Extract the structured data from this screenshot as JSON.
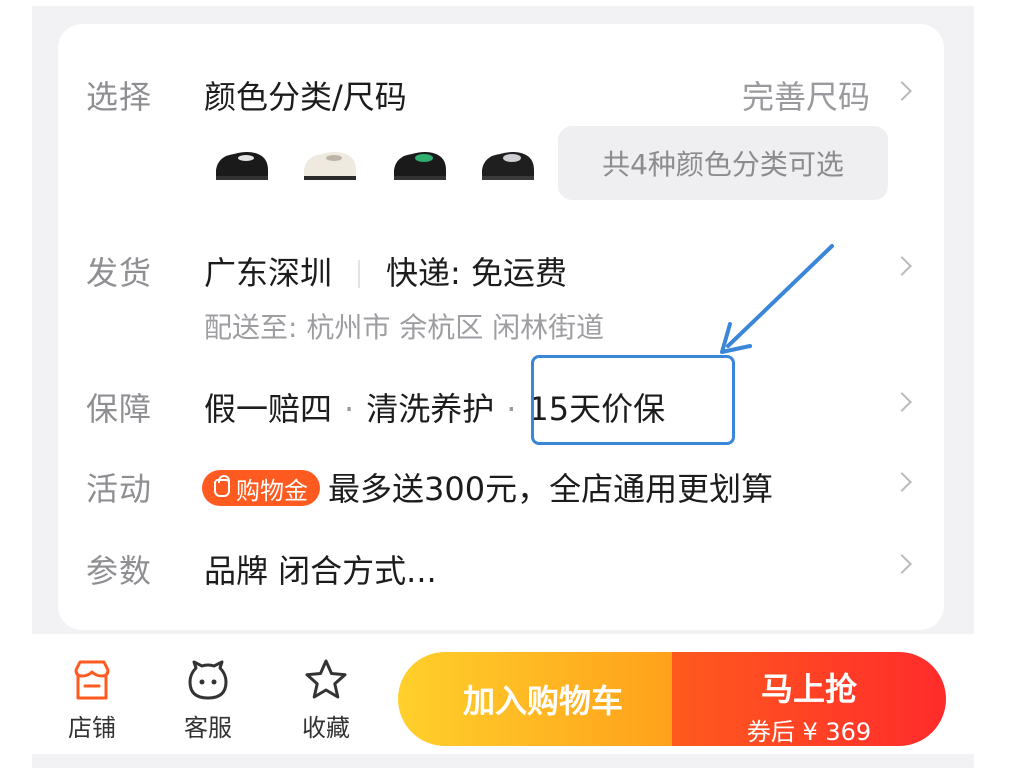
{
  "rows": {
    "select": {
      "label": "选择",
      "value": "颜色分类/尺码",
      "link": "完善尺码",
      "colors_pill": "共4种颜色分类可选",
      "thumbnails": [
        "shoe-black",
        "shoe-white",
        "shoe-green-black",
        "shoe-black-silver"
      ]
    },
    "shipping": {
      "label": "发货",
      "origin": "广东深圳",
      "courier": "快递: 免运费",
      "address": "配送至: 杭州市 余杭区 闲林街道"
    },
    "guarantee": {
      "label": "保障",
      "item1": "假一赔四",
      "item2": "清洗养护",
      "item3": "15天价保",
      "dot": "·"
    },
    "promo": {
      "label": "活动",
      "chip": "购物金",
      "text": "最多送300元，全店通用更划算"
    },
    "params": {
      "label": "参数",
      "value": "品牌 闭合方式..."
    }
  },
  "bottom_bar": {
    "store": "店铺",
    "service": "客服",
    "favorite": "收藏",
    "add_to_cart": "加入购物车",
    "buy_now": "马上抢",
    "coupon_price": "券后 ¥ 369"
  },
  "colors": {
    "accent_orange": "#ff5a1f",
    "annotation_blue": "#3a86d9",
    "cart_gradient": [
      "#ffd02b",
      "#ff9e1a"
    ],
    "buy_gradient": [
      "#ff5a1e",
      "#ff2b2b"
    ]
  }
}
